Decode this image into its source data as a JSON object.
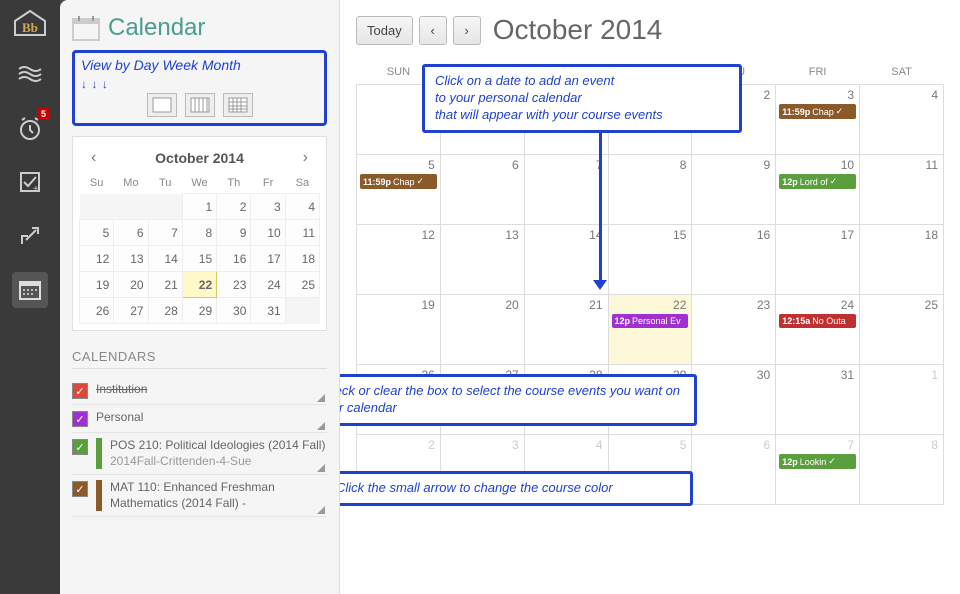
{
  "nav": {
    "badge_count": "5"
  },
  "sidebar": {
    "title": "Calendar",
    "view_toggle_label": "View by Day Week Month",
    "mini_cal": {
      "title": "October 2014",
      "days": [
        "Su",
        "Mo",
        "Tu",
        "We",
        "Th",
        "Fr",
        "Sa"
      ],
      "weeks": [
        [
          null,
          null,
          null,
          1,
          2,
          3,
          4
        ],
        [
          5,
          6,
          7,
          8,
          9,
          10,
          11
        ],
        [
          12,
          13,
          14,
          15,
          16,
          17,
          18
        ],
        [
          19,
          20,
          21,
          22,
          23,
          24,
          25
        ],
        [
          26,
          27,
          28,
          29,
          30,
          31,
          null
        ]
      ],
      "today": 22
    },
    "calendars_heading": "CALENDARS",
    "cal_items": [
      {
        "color": "#d94a3a",
        "checked": true,
        "label": "Institution",
        "struck": true
      },
      {
        "color": "#a030d0",
        "checked": true,
        "label": "Personal"
      },
      {
        "color": "#5a9e3e",
        "checked": true,
        "label": "POS 210: Political Ideologies (2014 Fall)",
        "sub": "2014Fall-Crittenden-4-Sue"
      },
      {
        "color": "#8b5a2b",
        "checked": true,
        "label": "MAT 110: Enhanced Freshman Mathematics (2014 Fall) -",
        "sub": ""
      }
    ]
  },
  "main": {
    "today_btn": "Today",
    "title": "October 2014",
    "days": [
      "SUN",
      "MON",
      "TUE",
      "WED",
      "THU",
      "FRI",
      "SAT"
    ],
    "events": {
      "28": [],
      "3": [
        {
          "time": "11:59p",
          "title": "Chap",
          "color": "#8b5a2b",
          "check": true
        }
      ],
      "5-sun": [
        {
          "time": "11:59p",
          "title": "Chap",
          "color": "#8b5a2b",
          "check": true
        }
      ],
      "10": [
        {
          "time": "12p",
          "title": "Lord of",
          "color": "#5a9e3e",
          "check": true
        }
      ],
      "22": [
        {
          "time": "12p",
          "title": "Personal Ev",
          "color": "#a030d0"
        }
      ],
      "24": [
        {
          "time": "12:15a",
          "title": "No Outa",
          "color": "#c03030"
        }
      ],
      "7-nov": [
        {
          "time": "12p",
          "title": "Lookin",
          "color": "#5a9e3e",
          "check": true
        }
      ]
    },
    "today": 22
  },
  "callouts": {
    "add_event": "Click on a date to add an event\nto your personal calendar\nthat will appear with your course events",
    "check_box": "Check or clear the box to select the course events you want on your calendar",
    "arrow_color": "Click the small arrow to change the course color"
  }
}
